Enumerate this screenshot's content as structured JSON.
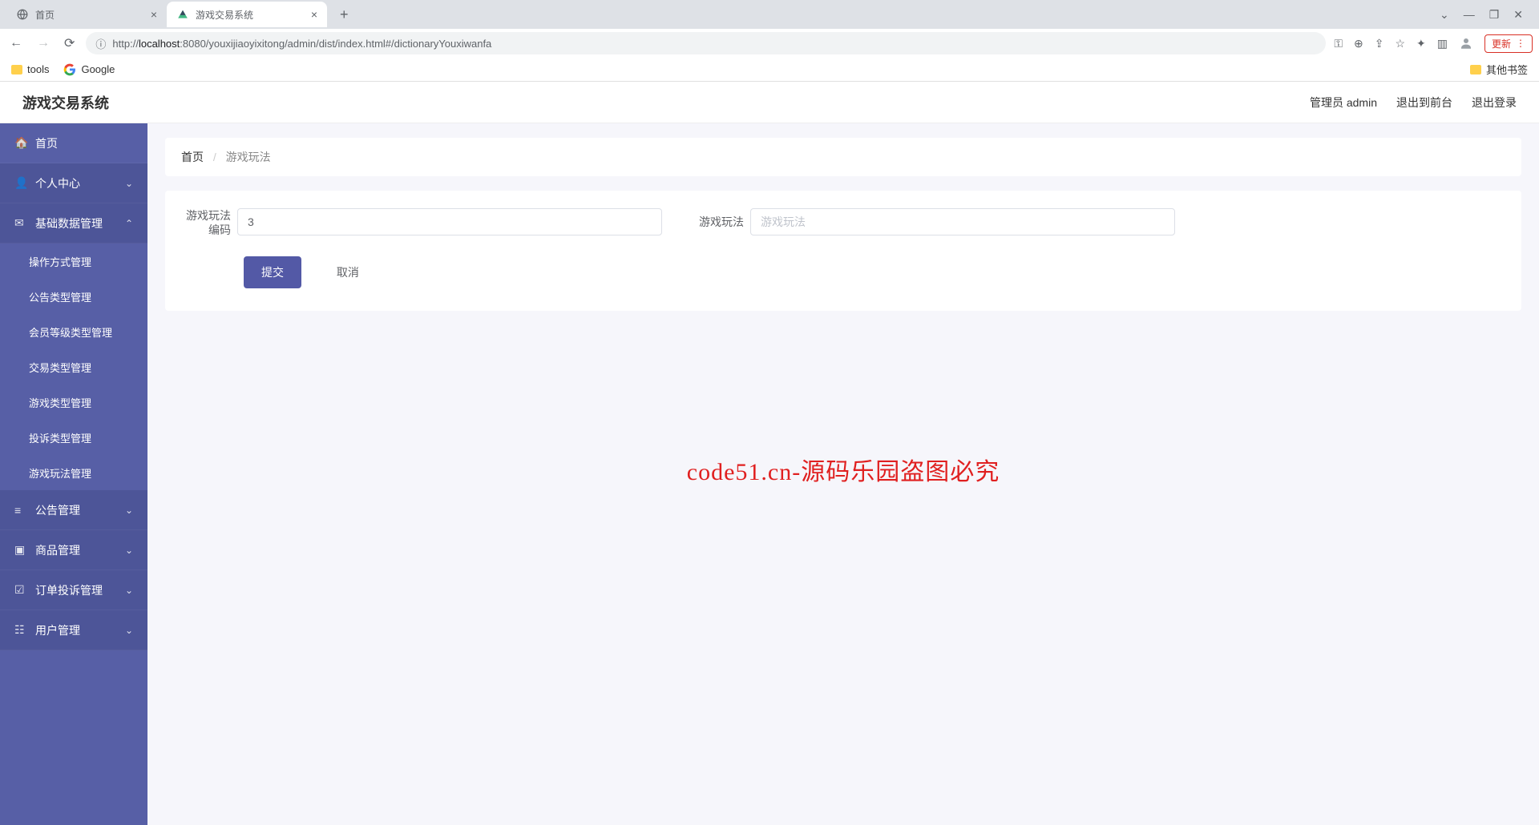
{
  "browser": {
    "tabs": [
      {
        "title": "首页"
      },
      {
        "title": "游戏交易系统"
      }
    ],
    "url_host": "localhost",
    "url_port_path": ":8080/youxijiaoyixitong/admin/dist/index.html#/dictionaryYouxiwanfa",
    "url_prefix": "http://",
    "update_label": "更新"
  },
  "bookmarks": {
    "tools": "tools",
    "google": "Google",
    "other": "其他书签"
  },
  "header": {
    "app_title": "游戏交易系统",
    "admin_label": "管理员 admin",
    "to_front": "退出到前台",
    "logout": "退出登录"
  },
  "sidebar": {
    "home": "首页",
    "personal": "个人中心",
    "basic_data": "基础数据管理",
    "sub": {
      "op_mode": "操作方式管理",
      "notice_type": "公告类型管理",
      "member_level": "会员等级类型管理",
      "trade_type": "交易类型管理",
      "game_type": "游戏类型管理",
      "complaint_type": "投诉类型管理",
      "gameplay": "游戏玩法管理"
    },
    "notice_mgmt": "公告管理",
    "goods_mgmt": "商品管理",
    "order_complaint": "订单投诉管理",
    "user_mgmt": "用户管理"
  },
  "breadcrumb": {
    "home": "首页",
    "current": "游戏玩法"
  },
  "form": {
    "label_code": "游戏玩法编码",
    "value_code": "3",
    "label_name": "游戏玩法",
    "placeholder_name": "游戏玩法",
    "submit": "提交",
    "cancel": "取消"
  },
  "watermark": {
    "center": "code51.cn-源码乐园盗图必究"
  }
}
